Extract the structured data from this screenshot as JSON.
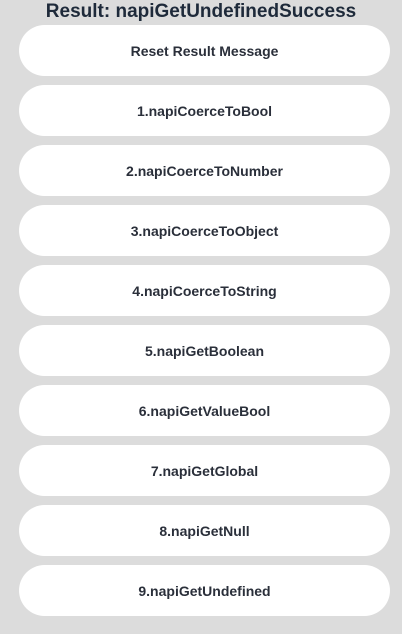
{
  "result": {
    "text": "Result: napiGetUndefinedSuccess"
  },
  "buttons": [
    {
      "label": "Reset Result Message"
    },
    {
      "label": "1.napiCoerceToBool"
    },
    {
      "label": "2.napiCoerceToNumber"
    },
    {
      "label": "3.napiCoerceToObject"
    },
    {
      "label": "4.napiCoerceToString"
    },
    {
      "label": "5.napiGetBoolean"
    },
    {
      "label": "6.napiGetValueBool"
    },
    {
      "label": "7.napiGetGlobal"
    },
    {
      "label": "8.napiGetNull"
    },
    {
      "label": "9.napiGetUndefined"
    }
  ],
  "colors": {
    "background": "#dcdcdc",
    "button_background": "#ffffff",
    "title_text": "#1e2a3a",
    "button_text": "#2a2f3a"
  }
}
